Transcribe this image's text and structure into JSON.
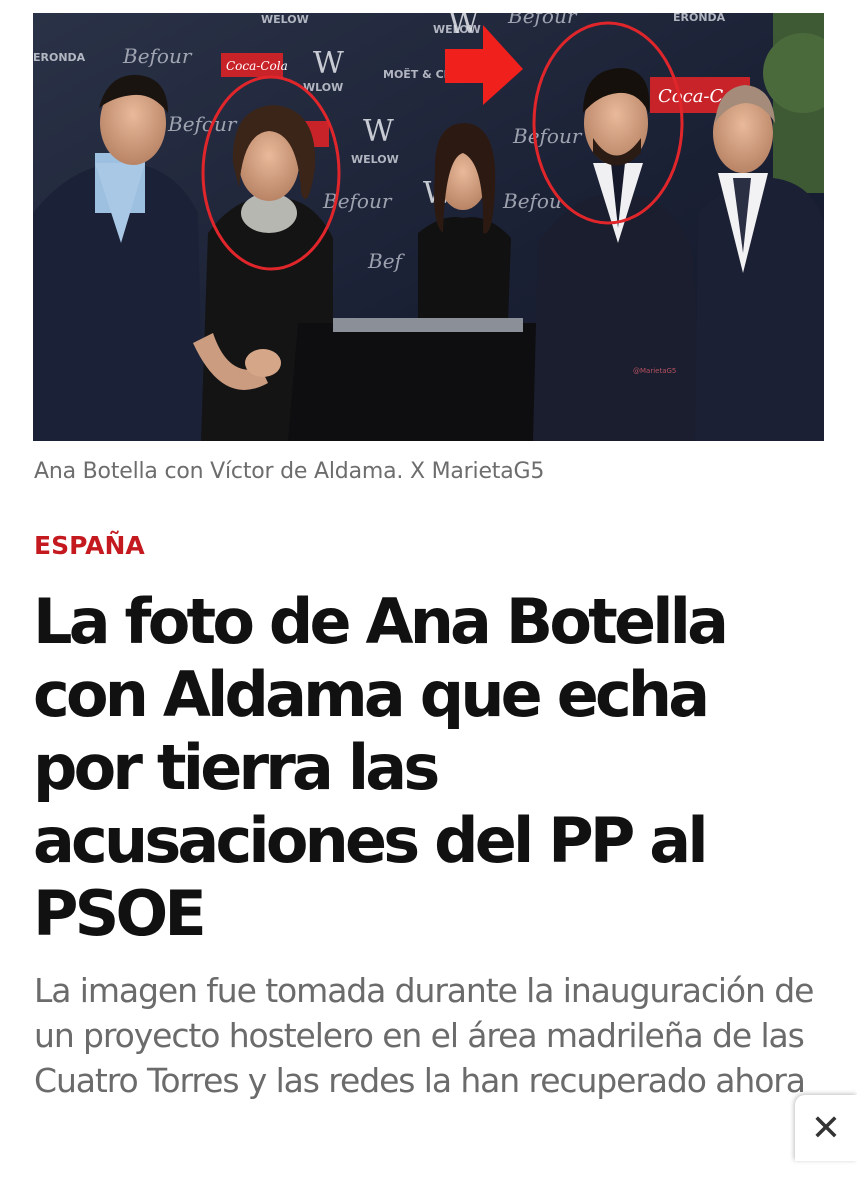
{
  "photo": {
    "caption": "Ana Botella con Víctor de Aldama. X MarietaG5",
    "backdrop_brands": [
      "WELOW",
      "Befour",
      "Coca-Cola",
      "ERONDA",
      "MOËT & CHANDON",
      "W"
    ],
    "watermark": "@MarietaG5",
    "highlight_color": "#e0262b"
  },
  "article": {
    "section": "ESPAÑA",
    "section_color": "#c41a1f",
    "headline": "La foto de Ana Botella con Aldama que echa por tierra las acusaciones del PP al PSOE",
    "subheadline": "La imagen fue tomada durante la inauguración de un proyecto hostelero en el área madrileña de las Cuatro Torres y las redes la han recuperado ahora"
  },
  "overlay": {
    "close_icon": "close-icon",
    "close_symbol": "✕"
  }
}
